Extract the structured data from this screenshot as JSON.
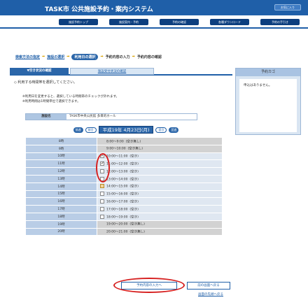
{
  "header": {
    "title": "TASK市 公共施設予約・案内システム",
    "user_button": "お気に入り"
  },
  "nav": {
    "items": [
      "施設予約トップ",
      "施設案内・予約",
      "予約の確認",
      "各種ダウンロード",
      "予約の手引き"
    ]
  },
  "breadcrumb": {
    "steps": [
      "検索方法の指定",
      "施設の選択",
      "利用日の選択",
      "予約内容の入力",
      "予約内容の確認"
    ],
    "current_index": 2
  },
  "tabs": {
    "active": "▼空き状況の確認",
    "inactive": "施設受付状況の確認"
  },
  "lead_text": "◇ 利用する時間帯を選択してください。",
  "notes": [
    "※利用日を変更すると、選択している時間帯のチェックが外れます。",
    "※利用時間は1時間単位で選択できます。"
  ],
  "facility": {
    "label": "施設名",
    "value": "TASK市中央公民館 多目的ホール"
  },
  "date_nav": {
    "prev_week": "前週",
    "prev_day": "前日",
    "current_date": "平成19年 4月23日(月)",
    "next_day": "翌日",
    "next_week": "翌週"
  },
  "slots": [
    {
      "time": "8時",
      "range": "8:00〜9:00",
      "status": "(空き無し)",
      "checkbox": false,
      "checked": false,
      "shaded": true
    },
    {
      "time": "9時",
      "range": "9:00〜10:00",
      "status": "(空き無し)",
      "checkbox": false,
      "checked": false,
      "shaded": true
    },
    {
      "time": "10時",
      "range": "10:00〜11:00",
      "status": "(空き)",
      "checkbox": true,
      "checked": true,
      "shaded": false
    },
    {
      "time": "11時",
      "range": "11:00〜12:00",
      "status": "(空き)",
      "checkbox": true,
      "checked": true,
      "shaded": false
    },
    {
      "time": "12時",
      "range": "12:00〜13:00",
      "status": "(空き)",
      "checkbox": true,
      "checked": false,
      "shaded": false
    },
    {
      "time": "13時",
      "range": "13:00〜14:00",
      "status": "(空き)",
      "checkbox": true,
      "checked": false,
      "shaded": false
    },
    {
      "time": "14時",
      "range": "14:00〜15:00",
      "status": "(空き)",
      "checkbox": true,
      "checked": false,
      "shaded": false,
      "gold": true
    },
    {
      "time": "15時",
      "range": "15:00〜16:00",
      "status": "(空き)",
      "checkbox": true,
      "checked": false,
      "shaded": false
    },
    {
      "time": "16時",
      "range": "16:00〜17:00",
      "status": "(空き)",
      "checkbox": true,
      "checked": false,
      "shaded": false
    },
    {
      "time": "17時",
      "range": "17:00〜18:00",
      "status": "(空き)",
      "checkbox": true,
      "checked": false,
      "shaded": false
    },
    {
      "time": "18時",
      "range": "18:00〜19:00",
      "status": "(空き)",
      "checkbox": true,
      "checked": false,
      "shaded": false
    },
    {
      "time": "19時",
      "range": "19:00〜20:00",
      "status": "(空き無し)",
      "checkbox": false,
      "checked": false,
      "shaded": true
    },
    {
      "time": "20時",
      "range": "20:00〜21:00",
      "status": "(空き無し)",
      "checkbox": false,
      "checked": false,
      "shaded": true
    }
  ],
  "buttons": {
    "next": "予約内容の入力へ",
    "back": "前の画面へ戻る",
    "top_link": "画面の先頭へ戻る"
  },
  "cart": {
    "title": "予約カゴ",
    "empty_text": "申込はありません。"
  },
  "colors": {
    "header_blue": "#1f5fa8",
    "highlight_red": "#d62020",
    "shaded_row": "#d2d2d2"
  }
}
